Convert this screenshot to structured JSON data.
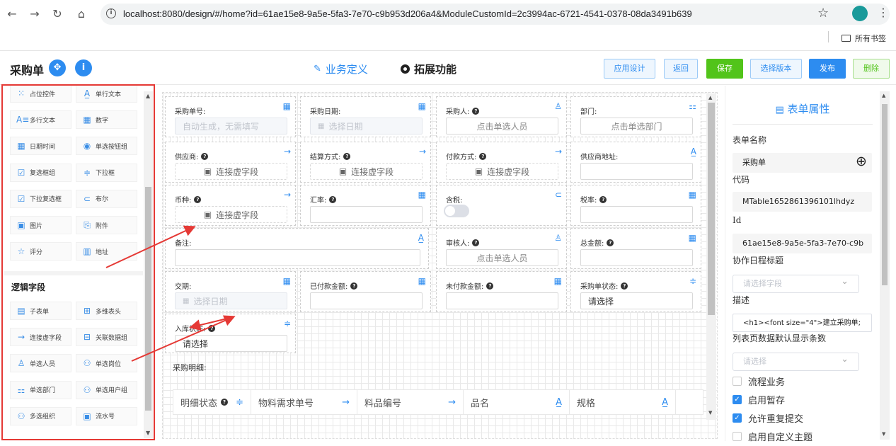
{
  "browser": {
    "url": "localhost:8080/design/#/home?id=61ae15e8-9a5e-5fa3-7e70-c9b953d206a4&ModuleCustomId=2c3994ac-6721-4541-0378-08da3491b639",
    "bookmarks_label": "所有书签"
  },
  "header": {
    "title": "采购单",
    "tab_business": "业务定义",
    "tab_extend": "拓展功能",
    "buttons": {
      "app_design": "应用设计",
      "back": "返回",
      "save": "保存",
      "choose_version": "选择版本",
      "publish": "发布",
      "delete": "删除"
    }
  },
  "left_panel": {
    "basic_items": [
      {
        "label": "占位控件",
        "icon": "grid-dots-icon"
      },
      {
        "label": "单行文本",
        "icon": "text-a-icon"
      },
      {
        "label": "多行文本",
        "icon": "multiline-text-icon"
      },
      {
        "label": "数字",
        "icon": "calculator-icon"
      },
      {
        "label": "日期时间",
        "icon": "calendar-icon"
      },
      {
        "label": "单选按钮组",
        "icon": "radio-icon"
      },
      {
        "label": "复选框组",
        "icon": "checkbox-icon"
      },
      {
        "label": "下拉框",
        "icon": "dropdown-icon"
      },
      {
        "label": "下拉复选框",
        "icon": "dropdown-check-icon"
      },
      {
        "label": "布尔",
        "icon": "toggle-icon"
      },
      {
        "label": "图片",
        "icon": "image-icon"
      },
      {
        "label": "附件",
        "icon": "attachment-icon"
      },
      {
        "label": "评分",
        "icon": "star-icon"
      },
      {
        "label": "地址",
        "icon": "map-icon"
      }
    ],
    "logic_section_title": "逻辑字段",
    "logic_items": [
      {
        "label": "子表单",
        "icon": "subform-icon"
      },
      {
        "label": "多维表头",
        "icon": "table-header-icon"
      },
      {
        "label": "连接虚字段",
        "icon": "arrow-right-icon"
      },
      {
        "label": "关联数据组",
        "icon": "related-data-icon"
      },
      {
        "label": "单选人员",
        "icon": "user-icon"
      },
      {
        "label": "单选岗位",
        "icon": "position-icon"
      },
      {
        "label": "单选部门",
        "icon": "department-icon"
      },
      {
        "label": "单选用户组",
        "icon": "user-group-icon"
      },
      {
        "label": "多选组织",
        "icon": "organization-icon"
      },
      {
        "label": "流水号",
        "icon": "serial-number-icon"
      }
    ]
  },
  "form": {
    "fields": [
      {
        "label": "采购单号:",
        "help": false,
        "icon": "calculator-icon",
        "value": "自动生成，无需填写",
        "kind": "disabled"
      },
      {
        "label": "采购日期:",
        "help": false,
        "icon": "calendar-icon",
        "value": "选择日期",
        "kind": "date"
      },
      {
        "label": "采购人:",
        "help": true,
        "icon": "user-icon",
        "value": "点击单选人员",
        "kind": "center"
      },
      {
        "label": "部门:",
        "help": false,
        "icon": "department-icon",
        "value": "点击单选部门",
        "kind": "center"
      },
      {
        "label": "供应商:",
        "help": true,
        "icon": "arrow-right-icon",
        "value": "连接虚字段",
        "kind": "virtual"
      },
      {
        "label": "结算方式:",
        "help": true,
        "icon": "arrow-right-icon",
        "value": "连接虚字段",
        "kind": "virtual"
      },
      {
        "label": "付款方式:",
        "help": true,
        "icon": "arrow-right-icon",
        "value": "连接虚字段",
        "kind": "virtual"
      },
      {
        "label": "供应商地址:",
        "help": false,
        "icon": "text-a-icon",
        "value": "",
        "kind": "text"
      },
      {
        "label": "币种:",
        "help": true,
        "icon": "arrow-right-icon",
        "value": "连接虚字段",
        "kind": "virtual"
      },
      {
        "label": "汇率:",
        "help": true,
        "icon": "calculator-icon",
        "value": "",
        "kind": "text"
      },
      {
        "label": "含税:",
        "help": false,
        "icon": "toggle-icon",
        "value": "",
        "kind": "toggle"
      },
      {
        "label": "税率:",
        "help": true,
        "icon": "calculator-icon",
        "value": "",
        "kind": "text"
      },
      {
        "label": "备注:",
        "help": false,
        "icon": "text-a-icon",
        "value": "",
        "kind": "text"
      },
      {
        "label": "审核人:",
        "help": true,
        "icon": "user-icon",
        "value": "点击单选人员",
        "kind": "center"
      },
      {
        "label": "总金额:",
        "help": true,
        "icon": "calculator-icon",
        "value": "",
        "kind": "text"
      },
      {
        "label": "交期:",
        "help": false,
        "icon": "calendar-icon",
        "value": "选择日期",
        "kind": "date"
      },
      {
        "label": "已付款金额:",
        "help": true,
        "icon": "calculator-icon",
        "value": "",
        "kind": "text"
      },
      {
        "label": "未付款金额:",
        "help": true,
        "icon": "calculator-icon",
        "value": "",
        "kind": "text"
      },
      {
        "label": "采购单状态:",
        "help": true,
        "icon": "dropdown-icon",
        "value": "请选择",
        "kind": "select"
      },
      {
        "label": "入库状态:",
        "help": true,
        "icon": "dropdown-icon",
        "value": "请选择",
        "kind": "select"
      }
    ],
    "detail_label": "采购明细:",
    "detail_columns": [
      {
        "label": "明细状态",
        "help": true,
        "icon": "dropdown-icon"
      },
      {
        "label": "物料需求单号",
        "help": false,
        "icon": "arrow-right-icon"
      },
      {
        "label": "料品编号",
        "help": false,
        "icon": "arrow-right-icon"
      },
      {
        "label": "品名",
        "help": false,
        "icon": "text-a-icon"
      },
      {
        "label": "规格",
        "help": false,
        "icon": "text-a-icon"
      }
    ]
  },
  "right_panel": {
    "title": "表单属性",
    "form_name_label": "表单名称",
    "form_name_value": "采购单",
    "code_label": "代码",
    "code_value": "MTable1652861396101lhdyz",
    "id_label": "Id",
    "id_value": "61ae15e8-9a5e-5fa3-7e70-c9b",
    "schedule_label": "协作日程标题",
    "schedule_placeholder": "请选择字段",
    "desc_label": "描述",
    "desc_value": "<h1><font size=\"4\">建立采购单;",
    "list_count_label": "列表页数据默认显示条数",
    "list_count_placeholder": "请选择",
    "options": [
      {
        "label": "流程业务",
        "checked": false
      },
      {
        "label": "启用暂存",
        "checked": true
      },
      {
        "label": "允许重复提交",
        "checked": true
      },
      {
        "label": "启用自定义主题",
        "checked": false
      }
    ]
  },
  "colors": {
    "accent": "#2d8cf0",
    "annotation": "#e53935",
    "save": "#52c41a"
  }
}
